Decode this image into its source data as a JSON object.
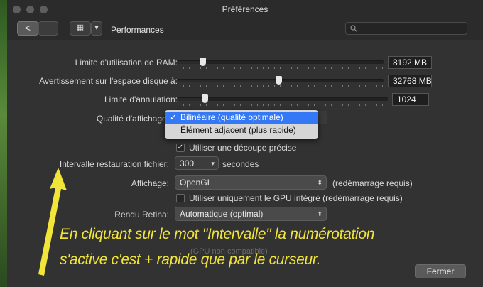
{
  "window": {
    "title": "Préférences"
  },
  "toolbar": {
    "back_label": "<",
    "forward_label": "",
    "grid_label": "▦",
    "dropdown_label": "▾",
    "section_title": "Performances",
    "search_placeholder": ""
  },
  "settings": {
    "ram": {
      "label": "Limite d'utilisation de RAM:",
      "value": "8192 MB",
      "slider_fraction": 0.12
    },
    "disk": {
      "label": "Avertissement sur l'espace disque à:",
      "value": "32768 MB",
      "slider_fraction": 0.49
    },
    "undo": {
      "label": "Limite d'annulation:",
      "value": "1024",
      "slider_fraction": 0.13
    },
    "display_quality": {
      "label": "Qualité d'affichage:"
    },
    "precise_clip": {
      "label": "Utiliser une découpe précise",
      "checked": true
    },
    "restore_interval": {
      "label": "Intervalle restauration fichier:",
      "value": "300",
      "unit": "secondes"
    },
    "display": {
      "label": "Affichage:",
      "value": "OpenGL",
      "note": "(redémarrage requis)"
    },
    "integrated_gpu": {
      "label": "Utiliser uniquement le GPU intégré (redémarrage requis)",
      "checked": false
    },
    "retina": {
      "label": "Rendu Retina:",
      "value": "Automatique (optimal)"
    },
    "gpu_note": "(GPU non compatible)"
  },
  "menu": {
    "items": [
      {
        "label": "Bilinéaire (qualité optimale)",
        "checked": true
      },
      {
        "label": "Élément adjacent (plus rapide)",
        "checked": false
      }
    ],
    "check_mark": "✓"
  },
  "close_button": {
    "label": "Fermer"
  },
  "annotation": {
    "line1": "En cliquant  sur le mot  \"Intervalle\" la numérotation",
    "line2": "s'active c'est + rapide que par le curseur.",
    "color": "#f2e53a"
  },
  "icons": {
    "popup_arrows": "⬍",
    "stepper_arrow": "▾",
    "checkmark": "✓"
  }
}
